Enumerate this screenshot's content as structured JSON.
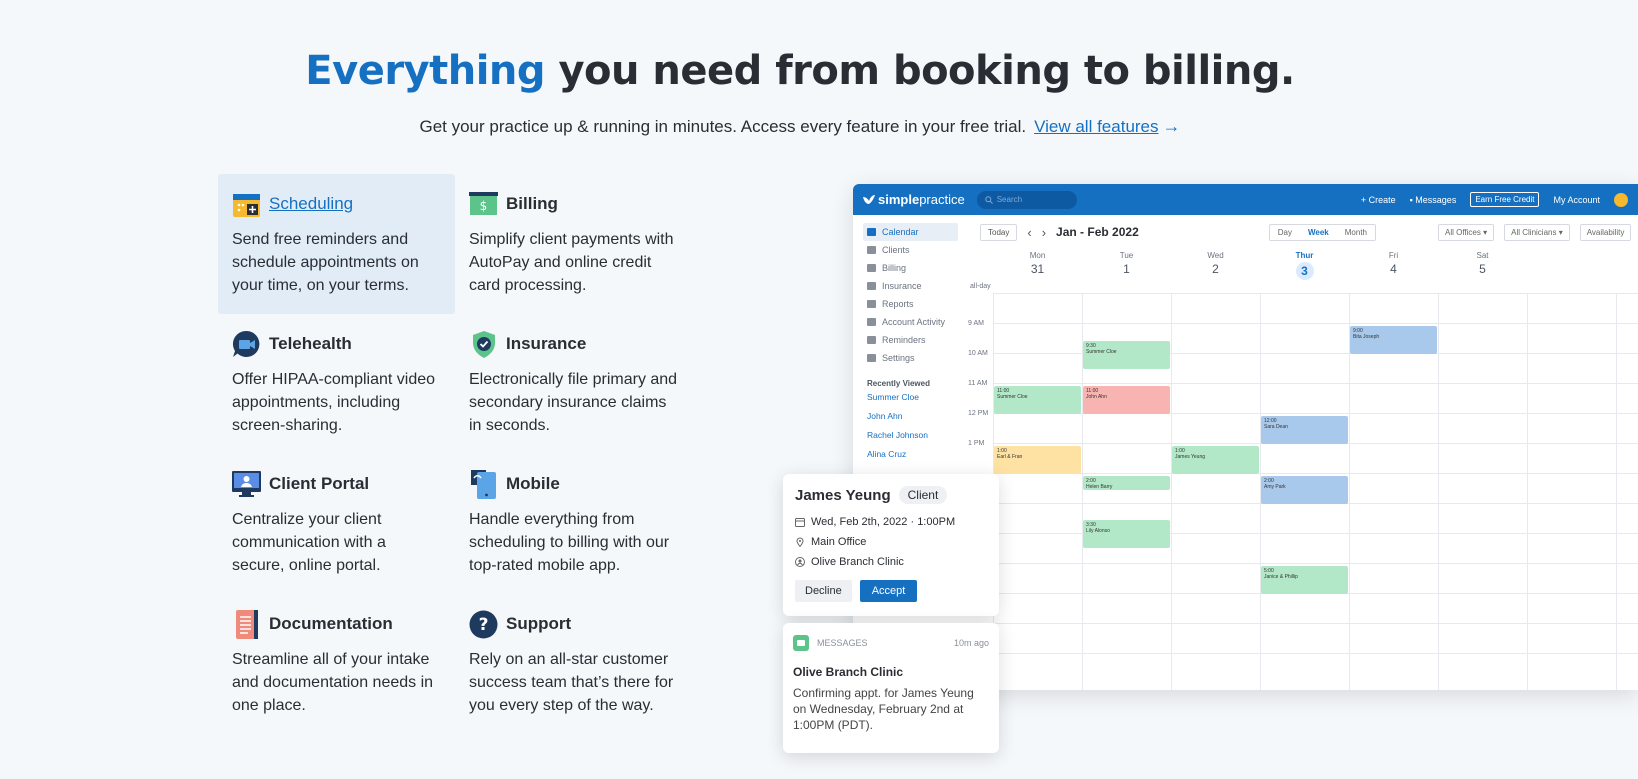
{
  "hero": {
    "title_accent": "Everything",
    "title_rest": " you need from booking to billing.",
    "subtitle": "Get your practice up & running in minutes. Access every feature in your free trial.",
    "link": "View all features",
    "link_arrow": "→"
  },
  "features": [
    {
      "title": "Scheduling",
      "desc": "Send free reminders and schedule appointments on your time, on your terms.",
      "icon": "calendar-icon"
    },
    {
      "title": "Billing",
      "desc": "Simplify client payments with AutoPay and online credit card processing.",
      "icon": "dollar-card-icon"
    },
    {
      "title": "Telehealth",
      "desc": "Offer HIPAA-compliant video appointments, including screen-sharing.",
      "icon": "video-chat-icon"
    },
    {
      "title": "Insurance",
      "desc": "Electronically file primary and secondary insurance claims in seconds.",
      "icon": "shield-check-icon"
    },
    {
      "title": "Client Portal",
      "desc": "Centralize your client communication with a secure, online portal.",
      "icon": "monitor-icon"
    },
    {
      "title": "Mobile",
      "desc": "Handle everything from scheduling to billing with our top-rated mobile app.",
      "icon": "phone-icon"
    },
    {
      "title": "Documentation",
      "desc": "Streamline all of your intake and documentation needs in one place.",
      "icon": "document-icon"
    },
    {
      "title": "Support",
      "desc": "Rely on an all-star customer success team that’s there for you every step of the way.",
      "icon": "question-icon"
    }
  ],
  "app": {
    "logo_bold": "simple",
    "logo_rest": "practice",
    "search_placeholder": "Search",
    "create": "Create",
    "messages": "Messages",
    "earn": "Earn Free Credit",
    "account": "My Account",
    "sidebar": [
      "Calendar",
      "Clients",
      "Billing",
      "Insurance",
      "Reports",
      "Account Activity",
      "Reminders",
      "Settings"
    ],
    "recently_viewed_title": "Recently Viewed",
    "recently_viewed": [
      "Summer Cloe",
      "John Ahn",
      "Rachel Johnson",
      "Alina Cruz"
    ],
    "today": "Today",
    "prev": "‹",
    "next": "›",
    "range": "Jan - Feb 2022",
    "views": [
      "Day",
      "Week",
      "Month"
    ],
    "offices": "All Offices",
    "clinicians": "All Clinicians",
    "availability": "Availability",
    "days": [
      {
        "name": "Mon",
        "num": "31"
      },
      {
        "name": "Tue",
        "num": "1"
      },
      {
        "name": "Wed",
        "num": "2"
      },
      {
        "name": "Thur",
        "num": "3"
      },
      {
        "name": "Fri",
        "num": "4"
      },
      {
        "name": "Sat",
        "num": "5"
      }
    ],
    "allday": "all-day",
    "times": [
      "9 AM",
      "10 AM",
      "11 AM",
      "12 PM",
      "1 PM"
    ],
    "events": [
      {
        "time": "9:30",
        "name": "Summer Cloe"
      },
      {
        "time": "9:00",
        "name": "Bita Joseph"
      },
      {
        "time": "11:00",
        "name": "Summer Cloe"
      },
      {
        "time": "11:00",
        "name": "John Ahn"
      },
      {
        "time": "12:00",
        "name": "Sara Dean"
      },
      {
        "time": "1:00",
        "name": "Earl & Fran"
      },
      {
        "time": "1:00",
        "name": "James Yeung"
      },
      {
        "time": "2:00",
        "name": "Helen Barry"
      },
      {
        "time": "2:00",
        "name": "Amy Park"
      },
      {
        "time": "3:30",
        "name": "Lily Alonso"
      },
      {
        "time": "5:00",
        "name": "Janice & Phillip"
      }
    ]
  },
  "request": {
    "name": "James Yeung",
    "badge": "Client",
    "date": "Wed, Feb 2th, 2022 · 1:00PM",
    "location": "Main Office",
    "clinic": "Olive Branch Clinic",
    "decline": "Decline",
    "accept": "Accept"
  },
  "message": {
    "label": "MESSAGES",
    "time": "10m ago",
    "title": "Olive Branch Clinic",
    "body": "Confirming appt. for James Yeung on Wednesday, February 2nd at 1:00PM (PDT)."
  },
  "colors": {
    "accent": "#1670c2",
    "event_green": "#b2e8c8",
    "event_red": "#f8b4b0",
    "event_blue": "#a9c9ec",
    "event_yellow": "#fde2a4"
  }
}
